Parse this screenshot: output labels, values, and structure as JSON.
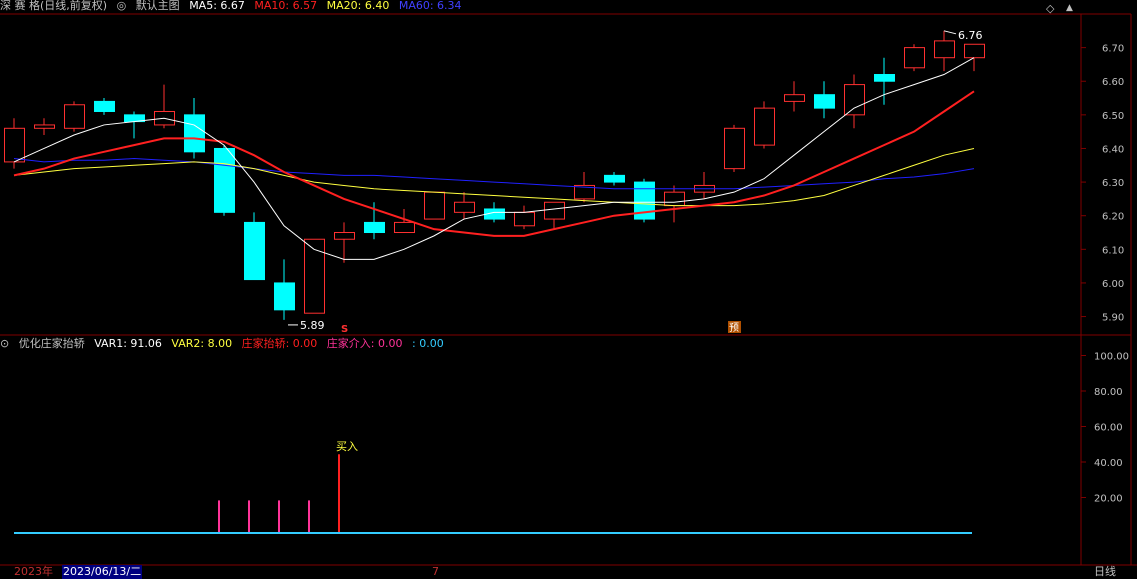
{
  "header": {
    "symbol": "深 赛 格(日线,前复权)",
    "main_chart_label": "默认主图",
    "ma5": "MA5: 6.67",
    "ma10": "MA10: 6.57",
    "ma20": "MA20: 6.40",
    "ma60": "MA60: 6.34"
  },
  "indicator_header": {
    "name": "优化庄家抬轿",
    "var1": "VAR1: 91.06",
    "var2": "VAR2: 8.00",
    "lift": "庄家抬轿: 0.00",
    "enter": "庄家介入: 0.00",
    "blank": ": 0.00"
  },
  "colors": {
    "up": "#ff3030",
    "down": "#00ffff",
    "ma5": "#ffffff",
    "ma10": "#ff2020",
    "ma20": "#ffff40",
    "ma60": "#2020ff",
    "grid": "#800000"
  },
  "annotations": {
    "high": "6.76",
    "low": "5.89",
    "buy_text": "买入",
    "s_marker": "S",
    "zhan_marker": "预"
  },
  "bottom": {
    "year": "2023年",
    "date": "2023/06/13/二",
    "month": "7",
    "period": "日线"
  },
  "chart_data": [
    {
      "type": "candlestick",
      "y_ticks": [
        "6.70",
        "6.60",
        "6.50",
        "6.40",
        "6.30",
        "6.20",
        "6.10",
        "6.00",
        "5.90"
      ],
      "ylim": [
        5.86,
        6.8
      ],
      "candles": [
        {
          "o": 6.36,
          "h": 6.49,
          "l": 6.34,
          "c": 6.46
        },
        {
          "o": 6.46,
          "h": 6.49,
          "l": 6.44,
          "c": 6.47
        },
        {
          "o": 6.46,
          "h": 6.54,
          "l": 6.45,
          "c": 6.53
        },
        {
          "o": 6.54,
          "h": 6.55,
          "l": 6.5,
          "c": 6.51
        },
        {
          "o": 6.5,
          "h": 6.51,
          "l": 6.43,
          "c": 6.48
        },
        {
          "o": 6.47,
          "h": 6.59,
          "l": 6.46,
          "c": 6.51
        },
        {
          "o": 6.5,
          "h": 6.55,
          "l": 6.37,
          "c": 6.39
        },
        {
          "o": 6.4,
          "h": 6.41,
          "l": 6.2,
          "c": 6.21
        },
        {
          "o": 6.18,
          "h": 6.21,
          "l": 6.01,
          "c": 6.01
        },
        {
          "o": 6.0,
          "h": 6.07,
          "l": 5.89,
          "c": 5.92
        },
        {
          "o": 5.91,
          "h": 6.13,
          "l": 5.91,
          "c": 6.13
        },
        {
          "o": 6.13,
          "h": 6.18,
          "l": 6.06,
          "c": 6.15
        },
        {
          "o": 6.18,
          "h": 6.24,
          "l": 6.13,
          "c": 6.15
        },
        {
          "o": 6.15,
          "h": 6.22,
          "l": 6.15,
          "c": 6.18
        },
        {
          "o": 6.19,
          "h": 6.27,
          "l": 6.19,
          "c": 6.27
        },
        {
          "o": 6.21,
          "h": 6.27,
          "l": 6.19,
          "c": 6.24
        },
        {
          "o": 6.22,
          "h": 6.24,
          "l": 6.18,
          "c": 6.19
        },
        {
          "o": 6.17,
          "h": 6.23,
          "l": 6.16,
          "c": 6.21
        },
        {
          "o": 6.19,
          "h": 6.24,
          "l": 6.16,
          "c": 6.24
        },
        {
          "o": 6.25,
          "h": 6.33,
          "l": 6.24,
          "c": 6.29
        },
        {
          "o": 6.32,
          "h": 6.33,
          "l": 6.29,
          "c": 6.3
        },
        {
          "o": 6.3,
          "h": 6.31,
          "l": 6.18,
          "c": 6.19
        },
        {
          "o": 6.23,
          "h": 6.29,
          "l": 6.18,
          "c": 6.27
        },
        {
          "o": 6.27,
          "h": 6.33,
          "l": 6.25,
          "c": 6.29
        },
        {
          "o": 6.34,
          "h": 6.47,
          "l": 6.33,
          "c": 6.46
        },
        {
          "o": 6.41,
          "h": 6.54,
          "l": 6.4,
          "c": 6.52
        },
        {
          "o": 6.54,
          "h": 6.6,
          "l": 6.51,
          "c": 6.56
        },
        {
          "o": 6.56,
          "h": 6.6,
          "l": 6.49,
          "c": 6.52
        },
        {
          "o": 6.5,
          "h": 6.62,
          "l": 6.46,
          "c": 6.59
        },
        {
          "o": 6.62,
          "h": 6.67,
          "l": 6.53,
          "c": 6.6
        },
        {
          "o": 6.64,
          "h": 6.71,
          "l": 6.63,
          "c": 6.7
        },
        {
          "o": 6.67,
          "h": 6.75,
          "l": 6.63,
          "c": 6.72
        },
        {
          "o": 6.67,
          "h": 6.71,
          "l": 6.63,
          "c": 6.71
        }
      ],
      "ma5": [
        6.36,
        6.4,
        6.44,
        6.47,
        6.48,
        6.49,
        6.47,
        6.41,
        6.3,
        6.17,
        6.1,
        6.07,
        6.07,
        6.1,
        6.14,
        6.19,
        6.21,
        6.21,
        6.22,
        6.23,
        6.24,
        6.24,
        6.24,
        6.25,
        6.27,
        6.31,
        6.38,
        6.45,
        6.52,
        6.56,
        6.59,
        6.62,
        6.67
      ],
      "ma10": [
        6.32,
        6.34,
        6.37,
        6.39,
        6.41,
        6.43,
        6.43,
        6.42,
        6.38,
        6.33,
        6.29,
        6.25,
        6.22,
        6.19,
        6.16,
        6.15,
        6.14,
        6.14,
        6.16,
        6.18,
        6.2,
        6.21,
        6.22,
        6.23,
        6.24,
        6.26,
        6.29,
        6.33,
        6.37,
        6.41,
        6.45,
        6.51,
        6.57
      ],
      "ma20": [
        6.32,
        6.33,
        6.34,
        6.345,
        6.35,
        6.355,
        6.36,
        6.355,
        6.34,
        6.32,
        6.3,
        6.29,
        6.28,
        6.275,
        6.27,
        6.265,
        6.26,
        6.255,
        6.25,
        6.245,
        6.24,
        6.235,
        6.23,
        6.23,
        6.23,
        6.235,
        6.245,
        6.26,
        6.29,
        6.32,
        6.35,
        6.38,
        6.4
      ],
      "ma60": [
        6.37,
        6.36,
        6.365,
        6.365,
        6.37,
        6.365,
        6.36,
        6.35,
        6.34,
        6.33,
        6.325,
        6.32,
        6.32,
        6.315,
        6.31,
        6.305,
        6.3,
        6.295,
        6.29,
        6.285,
        6.28,
        6.28,
        6.28,
        6.28,
        6.28,
        6.285,
        6.29,
        6.295,
        6.3,
        6.31,
        6.315,
        6.325,
        6.34
      ]
    },
    {
      "type": "bar",
      "y_ticks": [
        "100.00",
        "80.00",
        "60.00",
        "40.00",
        "20.00"
      ],
      "ylim": [
        0,
        110
      ],
      "bars": [
        {
          "index": 7,
          "value": 24,
          "color": "#ff3399"
        },
        {
          "index": 8,
          "value": 24,
          "color": "#ff3399"
        },
        {
          "index": 9,
          "value": 24,
          "color": "#ff3399"
        },
        {
          "index": 10,
          "value": 24,
          "color": "#ff3399"
        },
        {
          "index": 11,
          "value": 50,
          "color": "#ff2020"
        }
      ],
      "baseline": 0
    }
  ]
}
